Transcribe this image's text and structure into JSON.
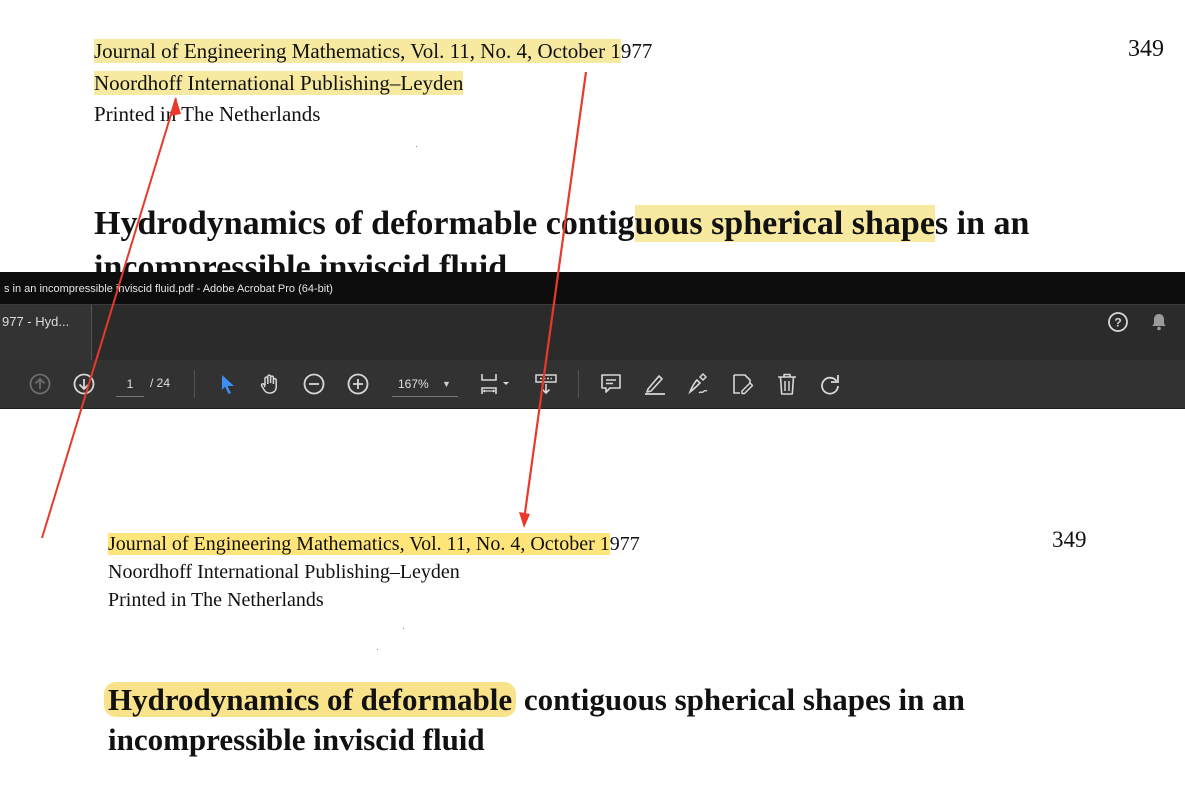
{
  "top_page": {
    "journal_pre": "Journal of Engineering Mathematics, Vol. 11, No. 4, October 1",
    "journal_post": "977",
    "publisher": "Noordhoff International Publishing–Leyden",
    "printed": "Printed in The Netherlands",
    "page_number": "349",
    "title_part1": "Hydrodynamics of deformable contig",
    "title_part2": "uous spherical shape",
    "title_part3": "s in an",
    "title_line2": "incompressible inviscid fluid"
  },
  "window": {
    "title": "s in an incompressible inviscid fluid.pdf - Adobe Acrobat Pro (64-bit)",
    "tab_label": "977 - Hyd..."
  },
  "toolbar": {
    "current_page": "1",
    "page_total": "/ 24",
    "zoom": "167%"
  },
  "icons": {
    "help": "help-icon",
    "bell": "bell-icon",
    "prev_page": "arrow-up-circle-icon",
    "next_page": "arrow-down-circle-icon",
    "select": "cursor-arrow-icon",
    "hand": "hand-icon",
    "zoom_out": "zoom-out-icon",
    "zoom_in": "zoom-in-icon",
    "page_fit": "page-fit-icon",
    "scroll_mode": "scroll-mode-icon",
    "comment": "comment-icon",
    "highlight": "highlight-pen-icon",
    "sign": "sign-icon",
    "edit": "edit-icon",
    "delete": "trash-icon",
    "rotate": "rotate-icon"
  },
  "bottom_page": {
    "journal_pre": "Journal of Engineering Mathematics, Vol. 11, No. 4, October 1",
    "journal_post": "977",
    "publisher": "Noordhoff International Publishing–Leyden",
    "printed": "Printed in The Netherlands",
    "page_number": "349",
    "title_highlight": "Hydrodynamics of deformable",
    "title_rest": " contiguous spherical shapes in an",
    "title_line2": "incompressible inviscid fluid"
  },
  "colors": {
    "highlight": "#ffe57a",
    "highlight_soft": "#f7eaa0",
    "arrow": "#e8392b",
    "titlebar_bg": "#0d0d0d",
    "toolbar_bg": "#323232",
    "select_tool_blue": "#3d8ef5"
  }
}
